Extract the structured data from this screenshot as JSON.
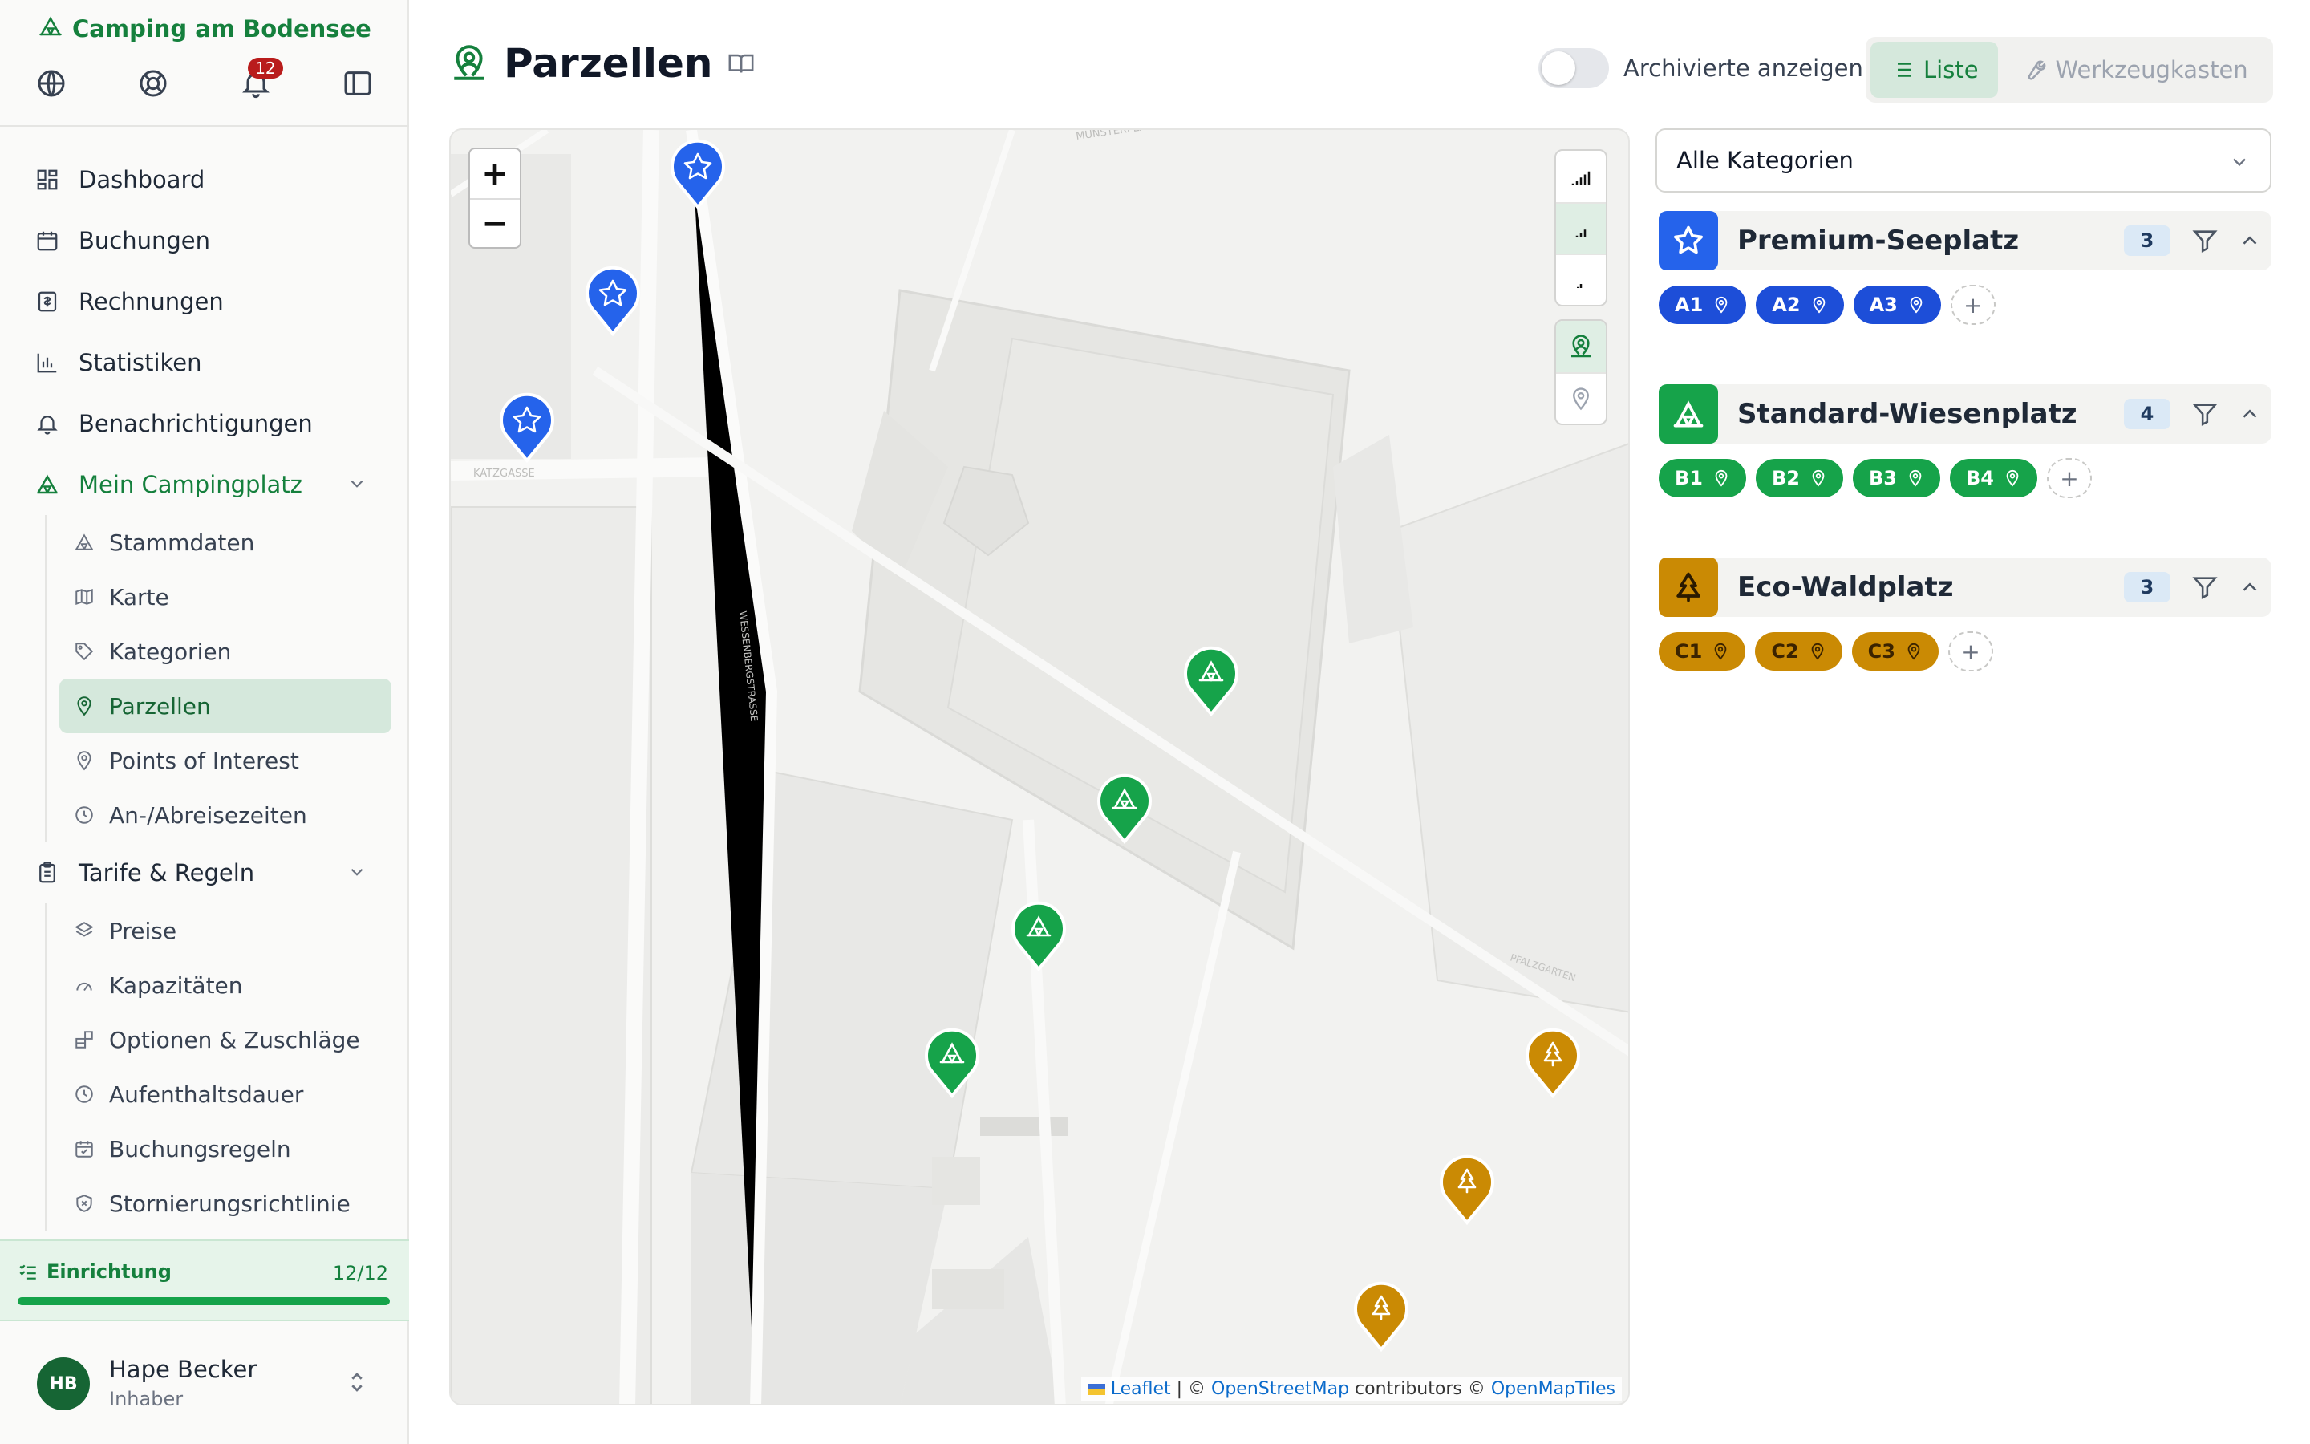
{
  "app": {
    "title": "Camping am Bodensee"
  },
  "sidebar": {
    "notification_count": "12",
    "icons": [
      "globe-icon",
      "lifebuoy-icon",
      "bell-icon",
      "panel-toggle-icon"
    ],
    "nav": [
      {
        "label": "Dashboard",
        "icon": "dashboard-icon"
      },
      {
        "label": "Buchungen",
        "icon": "calendar-icon"
      },
      {
        "label": "Rechnungen",
        "icon": "invoice-icon"
      },
      {
        "label": "Statistiken",
        "icon": "bar-chart-icon"
      },
      {
        "label": "Benachrichtigungen",
        "icon": "bell-icon"
      }
    ],
    "group_camp": {
      "label": "Mein Campingplatz",
      "items": [
        {
          "label": "Stammdaten",
          "icon": "tent-icon"
        },
        {
          "label": "Karte",
          "icon": "map-icon"
        },
        {
          "label": "Kategorien",
          "icon": "tag-icon"
        },
        {
          "label": "Parzellen",
          "icon": "map-pin-user-icon",
          "active": true
        },
        {
          "label": "Points of Interest",
          "icon": "pin-icon"
        },
        {
          "label": "An-/Abreisezeiten",
          "icon": "clock-icon"
        }
      ]
    },
    "group_rates": {
      "label": "Tarife & Regeln",
      "items": [
        {
          "label": "Preise",
          "icon": "layers-icon"
        },
        {
          "label": "Kapazitäten",
          "icon": "gauge-icon"
        },
        {
          "label": "Optionen & Zuschläge",
          "icon": "blocks-icon"
        },
        {
          "label": "Aufenthaltsdauer",
          "icon": "clock-icon"
        },
        {
          "label": "Buchungsregeln",
          "icon": "calendar-check-icon"
        },
        {
          "label": "Stornierungsrichtlinie",
          "icon": "shield-x-icon"
        }
      ]
    },
    "setup": {
      "label": "Einrichtung",
      "count": "12/12",
      "progress": 1.0
    },
    "user": {
      "initials": "HB",
      "name": "Hape Becker",
      "role": "Inhaber"
    }
  },
  "header": {
    "title": "Parzellen",
    "toggle_label": "Archivierte anzeigen",
    "toggle_on": false,
    "view_list": "Liste",
    "view_toolbox": "Werkzeugkasten"
  },
  "map": {
    "zoom_in": "+",
    "zoom_out": "−",
    "attribution": {
      "leaflet": "Leaflet",
      "sep1": " | © ",
      "osm": "OpenStreetMap",
      "sep2": " contributors © ",
      "omt": "OpenMapTiles"
    },
    "street_labels": [
      "MÜNSTERPLATZ",
      "KATZGASSE",
      "WESSENBERGSTRASSE",
      "PFALZGARTEN"
    ]
  },
  "filter": {
    "selected": "Alle Kategorien"
  },
  "categories": [
    {
      "name": "Premium-Seeplatz",
      "count": "3",
      "color": "#1d4ed8",
      "icon": "star-icon",
      "plots": [
        "A1",
        "A2",
        "A3"
      ],
      "add": "+"
    },
    {
      "name": "Standard-Wiesenplatz",
      "count": "4",
      "color": "#16a34a",
      "icon": "tent-icon",
      "plots": [
        "B1",
        "B2",
        "B3",
        "B4"
      ],
      "add": "+"
    },
    {
      "name": "Eco-Waldplatz",
      "count": "3",
      "color": "#ca8a04",
      "icon": "tree-icon",
      "plots": [
        "C1",
        "C2",
        "C3"
      ],
      "add": "+"
    }
  ]
}
